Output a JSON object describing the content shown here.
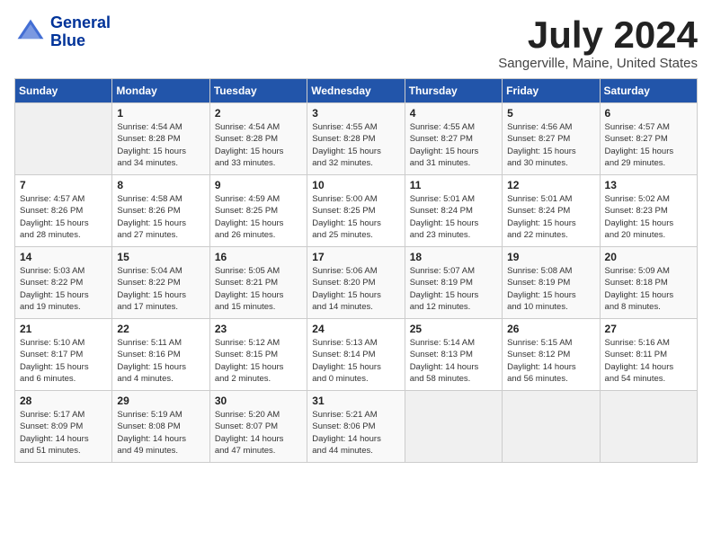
{
  "header": {
    "logo_line1": "General",
    "logo_line2": "Blue",
    "month": "July 2024",
    "location": "Sangerville, Maine, United States"
  },
  "days_of_week": [
    "Sunday",
    "Monday",
    "Tuesday",
    "Wednesday",
    "Thursday",
    "Friday",
    "Saturday"
  ],
  "weeks": [
    [
      {
        "day": "",
        "info": ""
      },
      {
        "day": "1",
        "info": "Sunrise: 4:54 AM\nSunset: 8:28 PM\nDaylight: 15 hours\nand 34 minutes."
      },
      {
        "day": "2",
        "info": "Sunrise: 4:54 AM\nSunset: 8:28 PM\nDaylight: 15 hours\nand 33 minutes."
      },
      {
        "day": "3",
        "info": "Sunrise: 4:55 AM\nSunset: 8:28 PM\nDaylight: 15 hours\nand 32 minutes."
      },
      {
        "day": "4",
        "info": "Sunrise: 4:55 AM\nSunset: 8:27 PM\nDaylight: 15 hours\nand 31 minutes."
      },
      {
        "day": "5",
        "info": "Sunrise: 4:56 AM\nSunset: 8:27 PM\nDaylight: 15 hours\nand 30 minutes."
      },
      {
        "day": "6",
        "info": "Sunrise: 4:57 AM\nSunset: 8:27 PM\nDaylight: 15 hours\nand 29 minutes."
      }
    ],
    [
      {
        "day": "7",
        "info": "Sunrise: 4:57 AM\nSunset: 8:26 PM\nDaylight: 15 hours\nand 28 minutes."
      },
      {
        "day": "8",
        "info": "Sunrise: 4:58 AM\nSunset: 8:26 PM\nDaylight: 15 hours\nand 27 minutes."
      },
      {
        "day": "9",
        "info": "Sunrise: 4:59 AM\nSunset: 8:25 PM\nDaylight: 15 hours\nand 26 minutes."
      },
      {
        "day": "10",
        "info": "Sunrise: 5:00 AM\nSunset: 8:25 PM\nDaylight: 15 hours\nand 25 minutes."
      },
      {
        "day": "11",
        "info": "Sunrise: 5:01 AM\nSunset: 8:24 PM\nDaylight: 15 hours\nand 23 minutes."
      },
      {
        "day": "12",
        "info": "Sunrise: 5:01 AM\nSunset: 8:24 PM\nDaylight: 15 hours\nand 22 minutes."
      },
      {
        "day": "13",
        "info": "Sunrise: 5:02 AM\nSunset: 8:23 PM\nDaylight: 15 hours\nand 20 minutes."
      }
    ],
    [
      {
        "day": "14",
        "info": "Sunrise: 5:03 AM\nSunset: 8:22 PM\nDaylight: 15 hours\nand 19 minutes."
      },
      {
        "day": "15",
        "info": "Sunrise: 5:04 AM\nSunset: 8:22 PM\nDaylight: 15 hours\nand 17 minutes."
      },
      {
        "day": "16",
        "info": "Sunrise: 5:05 AM\nSunset: 8:21 PM\nDaylight: 15 hours\nand 15 minutes."
      },
      {
        "day": "17",
        "info": "Sunrise: 5:06 AM\nSunset: 8:20 PM\nDaylight: 15 hours\nand 14 minutes."
      },
      {
        "day": "18",
        "info": "Sunrise: 5:07 AM\nSunset: 8:19 PM\nDaylight: 15 hours\nand 12 minutes."
      },
      {
        "day": "19",
        "info": "Sunrise: 5:08 AM\nSunset: 8:19 PM\nDaylight: 15 hours\nand 10 minutes."
      },
      {
        "day": "20",
        "info": "Sunrise: 5:09 AM\nSunset: 8:18 PM\nDaylight: 15 hours\nand 8 minutes."
      }
    ],
    [
      {
        "day": "21",
        "info": "Sunrise: 5:10 AM\nSunset: 8:17 PM\nDaylight: 15 hours\nand 6 minutes."
      },
      {
        "day": "22",
        "info": "Sunrise: 5:11 AM\nSunset: 8:16 PM\nDaylight: 15 hours\nand 4 minutes."
      },
      {
        "day": "23",
        "info": "Sunrise: 5:12 AM\nSunset: 8:15 PM\nDaylight: 15 hours\nand 2 minutes."
      },
      {
        "day": "24",
        "info": "Sunrise: 5:13 AM\nSunset: 8:14 PM\nDaylight: 15 hours\nand 0 minutes."
      },
      {
        "day": "25",
        "info": "Sunrise: 5:14 AM\nSunset: 8:13 PM\nDaylight: 14 hours\nand 58 minutes."
      },
      {
        "day": "26",
        "info": "Sunrise: 5:15 AM\nSunset: 8:12 PM\nDaylight: 14 hours\nand 56 minutes."
      },
      {
        "day": "27",
        "info": "Sunrise: 5:16 AM\nSunset: 8:11 PM\nDaylight: 14 hours\nand 54 minutes."
      }
    ],
    [
      {
        "day": "28",
        "info": "Sunrise: 5:17 AM\nSunset: 8:09 PM\nDaylight: 14 hours\nand 51 minutes."
      },
      {
        "day": "29",
        "info": "Sunrise: 5:19 AM\nSunset: 8:08 PM\nDaylight: 14 hours\nand 49 minutes."
      },
      {
        "day": "30",
        "info": "Sunrise: 5:20 AM\nSunset: 8:07 PM\nDaylight: 14 hours\nand 47 minutes."
      },
      {
        "day": "31",
        "info": "Sunrise: 5:21 AM\nSunset: 8:06 PM\nDaylight: 14 hours\nand 44 minutes."
      },
      {
        "day": "",
        "info": ""
      },
      {
        "day": "",
        "info": ""
      },
      {
        "day": "",
        "info": ""
      }
    ]
  ]
}
